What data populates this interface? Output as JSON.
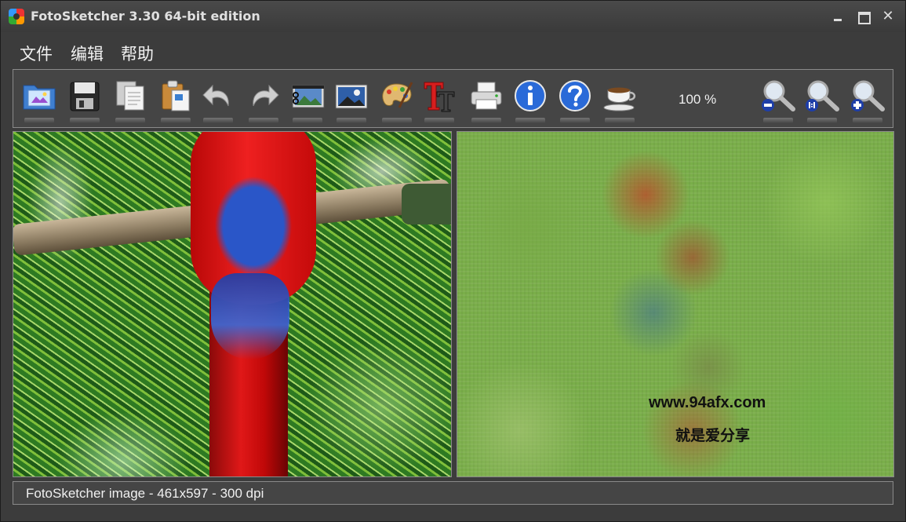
{
  "window": {
    "title": "FotoSketcher 3.30 64-bit edition",
    "controls": {
      "close_glyph": "✕"
    }
  },
  "menu": {
    "items": [
      {
        "label": "文件"
      },
      {
        "label": "编辑"
      },
      {
        "label": "帮助"
      }
    ]
  },
  "toolbar": {
    "zoom_level": "100 %",
    "tools": [
      {
        "icon": "open-folder-icon"
      },
      {
        "icon": "save-disk-icon"
      },
      {
        "icon": "copy-icon"
      },
      {
        "icon": "paste-clipboard-icon"
      },
      {
        "icon": "undo-arrow-icon"
      },
      {
        "icon": "redo-arrow-icon"
      },
      {
        "icon": "crop-scissors-icon"
      },
      {
        "icon": "image-landscape-icon"
      },
      {
        "icon": "palette-brush-icon"
      },
      {
        "icon": "text-tool-icon"
      },
      {
        "icon": "printer-icon"
      },
      {
        "icon": "info-icon"
      },
      {
        "icon": "help-question-icon"
      },
      {
        "icon": "coffee-cup-icon"
      },
      {
        "icon": "zoom-out-icon"
      },
      {
        "icon": "zoom-actual-icon"
      },
      {
        "icon": "zoom-in-icon"
      }
    ]
  },
  "panes": {
    "watermark_url": "www.94afx.com",
    "watermark_slogan": "就是爱分享"
  },
  "status": {
    "text": "FotoSketcher image - 461x597 - 300 dpi"
  },
  "colors": {
    "window_bg": "#3c3c3c",
    "toolbar_bg": "#454545",
    "border": "#8a8a8a",
    "text": "#f0f0f0"
  }
}
